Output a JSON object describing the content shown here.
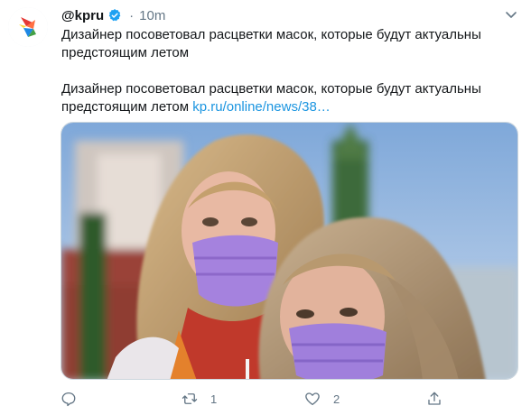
{
  "tweet": {
    "handle": "@kpru",
    "separator": "·",
    "time": "10m",
    "text_line1": "Дизайнер посоветовал расцветки масок, которые будут актуальны",
    "text_line2": "предстоящим летом",
    "text_line3": "Дизайнер посоветовал расцветки масок, которые будут актуальны",
    "text_line4_prefix": "предстоящим летом ",
    "link_text": "kp.ru/online/news/38…"
  },
  "actions": {
    "retweets": "1",
    "likes": "2"
  },
  "colors": {
    "link": "#1b95e0",
    "muted": "#657786",
    "verified": "#1da1f2",
    "mask": "#9b6fd8"
  },
  "icons": {
    "reply": "reply-icon",
    "retweet": "retweet-icon",
    "like": "heart-icon",
    "share": "share-icon",
    "caret": "chevron-down-icon",
    "verified": "verified-badge-icon"
  }
}
